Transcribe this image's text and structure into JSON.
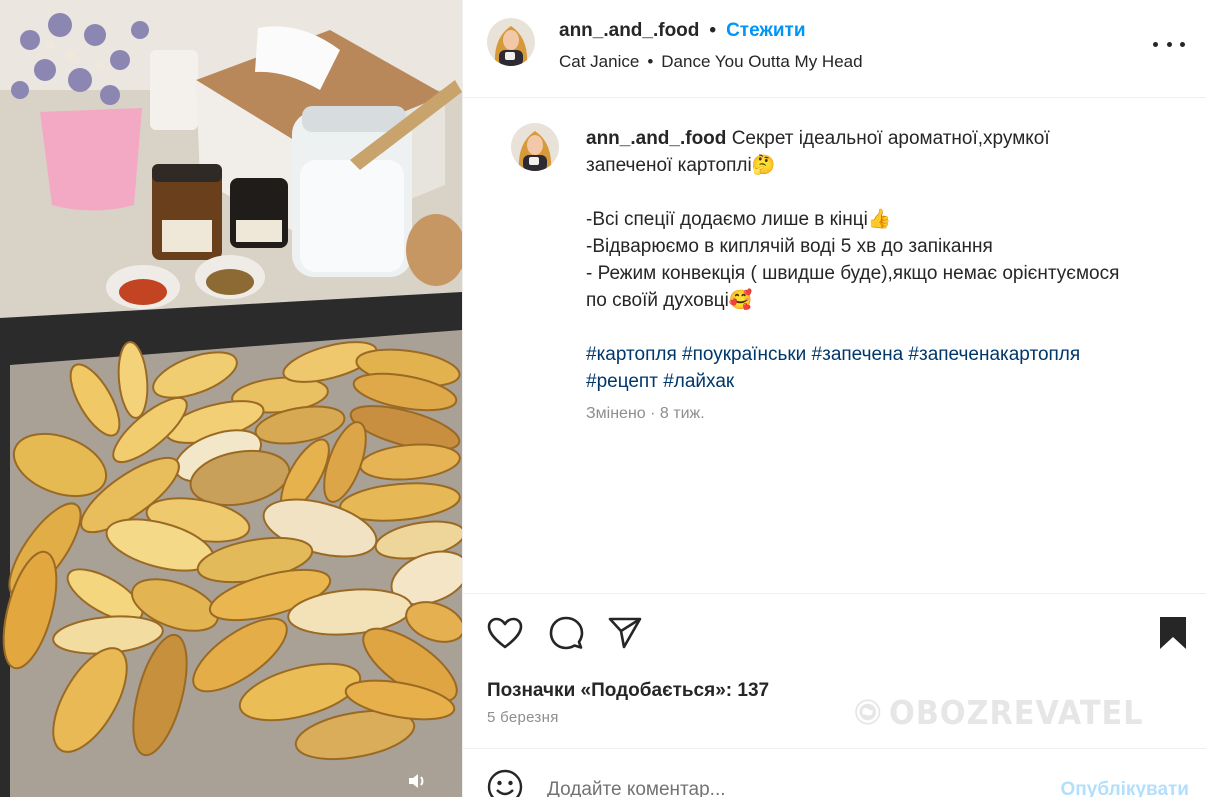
{
  "post": {
    "author": "ann_.and_.food",
    "follow_label": "Стежити",
    "separator": "•",
    "music": {
      "artist": "Cat Janice",
      "track": "Dance You Outta My Head"
    }
  },
  "caption": {
    "author": "ann_.and_.food",
    "title": "Секрет ідеальної ароматної,хрумкої запеченої картоплі🤔",
    "tips": "-Всі спеції додаємо лише в кінці👍\n-Відварюємо в киплячій воді 5 хв до запікання\n- Режим конвекція ( швидше буде),якщо немає орієнтуємося по своїй духовці🥰",
    "hashtags": "#картопля #поукраїнськи #запечена #запеченакартопля #рецепт #лайхак",
    "edited": "Змінено",
    "age": "8 тиж."
  },
  "stats": {
    "likes_label": "Позначки «Подобається»: 137",
    "date": "5 березня"
  },
  "comment": {
    "placeholder": "Додайте коментар...",
    "publish_label": "Опублікувати"
  },
  "watermark": {
    "text": "OBOZREVATEL"
  },
  "icons": {
    "like": "heart-icon",
    "comment": "comment-icon",
    "share": "send-icon",
    "save": "bookmark-icon",
    "more": "more-horizontal-icon",
    "mute": "speaker-icon",
    "emoji": "emoji-icon"
  },
  "colors": {
    "accent": "#0095f6",
    "hashtag": "#00376b",
    "muted": "#8e8e8e",
    "publish_disabled": "#b2dffc"
  }
}
